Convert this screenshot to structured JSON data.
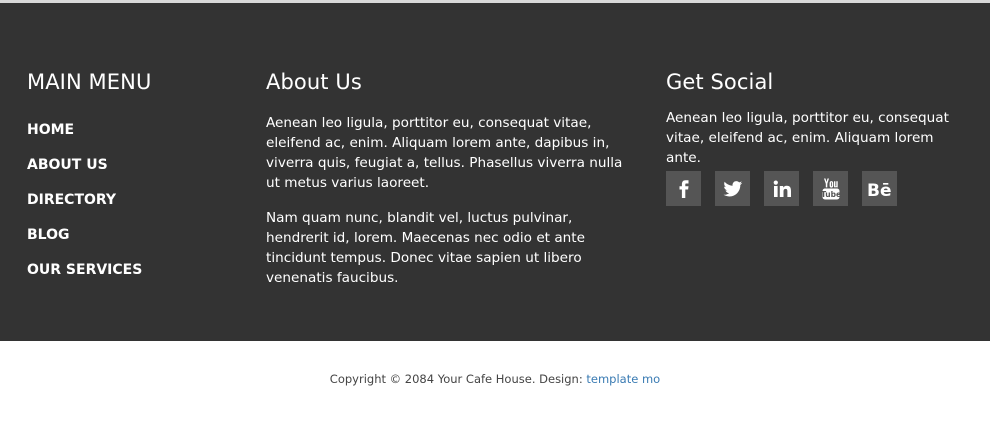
{
  "main_menu": {
    "title": "MAIN MENU",
    "items": [
      {
        "label": "HOME"
      },
      {
        "label": "ABOUT US"
      },
      {
        "label": "DIRECTORY"
      },
      {
        "label": "BLOG"
      },
      {
        "label": "OUR SERVICES"
      }
    ]
  },
  "about": {
    "title": "About Us",
    "paragraph_1": "Aenean leo ligula, porttitor eu, consequat vitae, eleifend ac, enim. Aliquam lorem ante, dapibus in, viverra quis, feugiat a, tellus. Phasellus viverra nulla ut metus varius laoreet.",
    "paragraph_2": "Nam quam nunc, blandit vel, luctus pulvinar, hendrerit id, lorem. Maecenas nec odio et ante tincidunt tempus. Donec vitae sapien ut libero venenatis faucibus."
  },
  "social": {
    "title": "Get Social",
    "text": "Aenean leo ligula, porttitor eu, consequat vitae, eleifend ac, enim. Aliquam lorem ante.",
    "icons": [
      "facebook-icon",
      "twitter-icon",
      "linkedin-icon",
      "youtube-icon",
      "behance-icon"
    ]
  },
  "copyright": {
    "text": "Copyright © 2084 Your Cafe House. Design: ",
    "link_label": "template mo"
  },
  "colors": {
    "footer_background": "#333333",
    "icon_background": "#555555",
    "link": "#3a7bb3"
  }
}
